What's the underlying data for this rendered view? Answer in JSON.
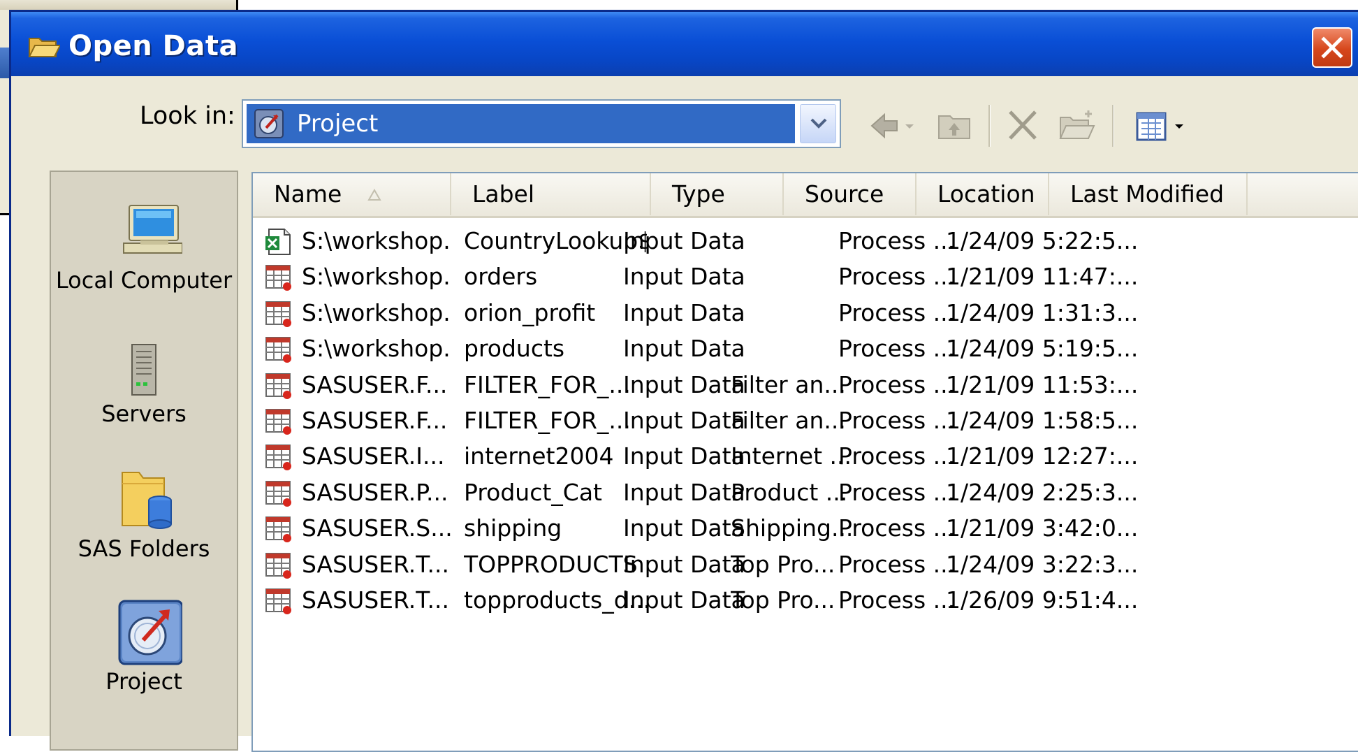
{
  "dialog": {
    "title": "Open Data",
    "look_in_label": "Look in:",
    "look_in_value": "Project"
  },
  "toolbar": {
    "icons": [
      "back-arrow-icon",
      "up-folder-icon",
      "delete-icon",
      "new-folder-icon",
      "view-menu-icon"
    ]
  },
  "places": [
    {
      "label": "Local Computer",
      "icon": "computer-icon"
    },
    {
      "label": "Servers",
      "icon": "server-icon"
    },
    {
      "label": "SAS Folders",
      "icon": "sas-folder-icon"
    },
    {
      "label": "Project",
      "icon": "project-icon"
    }
  ],
  "columns": [
    "Name",
    "Label",
    "Type",
    "Source",
    "Location",
    "Last Modified"
  ],
  "rows": [
    {
      "icon": "excel-file-icon",
      "name": "S:\\workshop...",
      "label": "CountryLookup$",
      "type": "Input Data",
      "source": "",
      "location": "Process ...",
      "modified": "1/24/09 5:22:5..."
    },
    {
      "icon": "sas-table-icon",
      "name": "S:\\workshop...",
      "label": "orders",
      "type": "Input Data",
      "source": "",
      "location": "Process ...",
      "modified": "1/21/09 11:47:..."
    },
    {
      "icon": "sas-table-icon",
      "name": "S:\\workshop...",
      "label": "orion_profit",
      "type": "Input Data",
      "source": "",
      "location": "Process ...",
      "modified": "1/24/09 1:31:3..."
    },
    {
      "icon": "sas-table-icon",
      "name": "S:\\workshop...",
      "label": "products",
      "type": "Input Data",
      "source": "",
      "location": "Process ...",
      "modified": "1/24/09 5:19:5..."
    },
    {
      "icon": "sas-table-icon",
      "name": "SASUSER.F...",
      "label": "FILTER_FOR_...",
      "type": "Input Data",
      "source": "Filter an...",
      "location": "Process ...",
      "modified": "1/21/09 11:53:..."
    },
    {
      "icon": "sas-table-icon",
      "name": "SASUSER.F...",
      "label": "FILTER_FOR_...",
      "type": "Input Data",
      "source": "Filter an...",
      "location": "Process ...",
      "modified": "1/24/09 1:58:5..."
    },
    {
      "icon": "sas-table-icon",
      "name": "SASUSER.I...",
      "label": "internet2004",
      "type": "Input Data",
      "source": "Internet ...",
      "location": "Process ...",
      "modified": "1/21/09 12:27:..."
    },
    {
      "icon": "sas-table-icon",
      "name": "SASUSER.P...",
      "label": "Product_Cat",
      "type": "Input Data",
      "source": "Product ...",
      "location": "Process ...",
      "modified": "1/24/09 2:25:3..."
    },
    {
      "icon": "sas-table-icon",
      "name": "SASUSER.S...",
      "label": "shipping",
      "type": "Input Data",
      "source": "Shipping...",
      "location": "Process ...",
      "modified": "1/21/09 3:42:0..."
    },
    {
      "icon": "sas-table-icon",
      "name": "SASUSER.T...",
      "label": "TOPPRODUCTS",
      "type": "Input Data",
      "source": "Top Pro...",
      "location": "Process ...",
      "modified": "1/24/09 3:22:3..."
    },
    {
      "icon": "sas-table-icon",
      "name": "SASUSER.T...",
      "label": "topproducts_d...",
      "type": "Input Data",
      "source": "Top Pro...",
      "location": "Process ...",
      "modified": "1/26/09 9:51:4..."
    }
  ]
}
